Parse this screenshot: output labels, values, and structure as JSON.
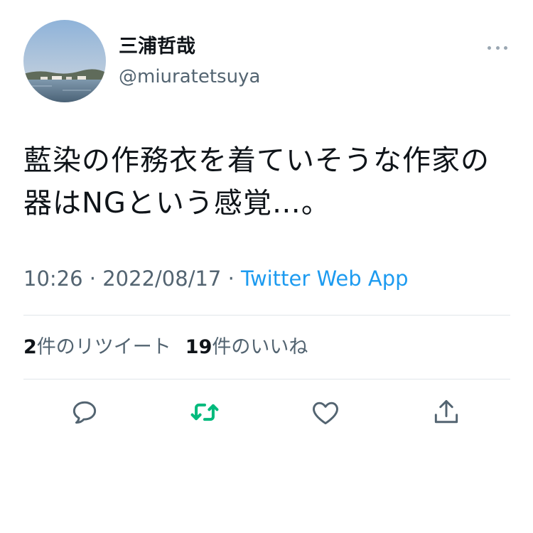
{
  "user": {
    "display_name": "三浦哲哉",
    "handle": "@miuratetsuya"
  },
  "tweet": {
    "text": "藍染の作務衣を着ていそうな作家の器はNGという感覚…。",
    "time": "10:26",
    "separator": " · ",
    "date": "2022/08/17",
    "source": "Twitter Web App"
  },
  "stats": {
    "retweets_count": "2",
    "retweets_label": "件のリツイート",
    "likes_count": "19",
    "likes_label": "件のいいね"
  },
  "actions": {
    "reply_icon": "reply-icon",
    "retweet_icon": "retweet-icon",
    "like_icon": "heart-icon",
    "share_icon": "share-icon"
  },
  "colors": {
    "accent": "#1d9bf0",
    "retweet_green": "#00ba7c",
    "secondary_text": "#536471",
    "icon_gray": "#536471"
  }
}
